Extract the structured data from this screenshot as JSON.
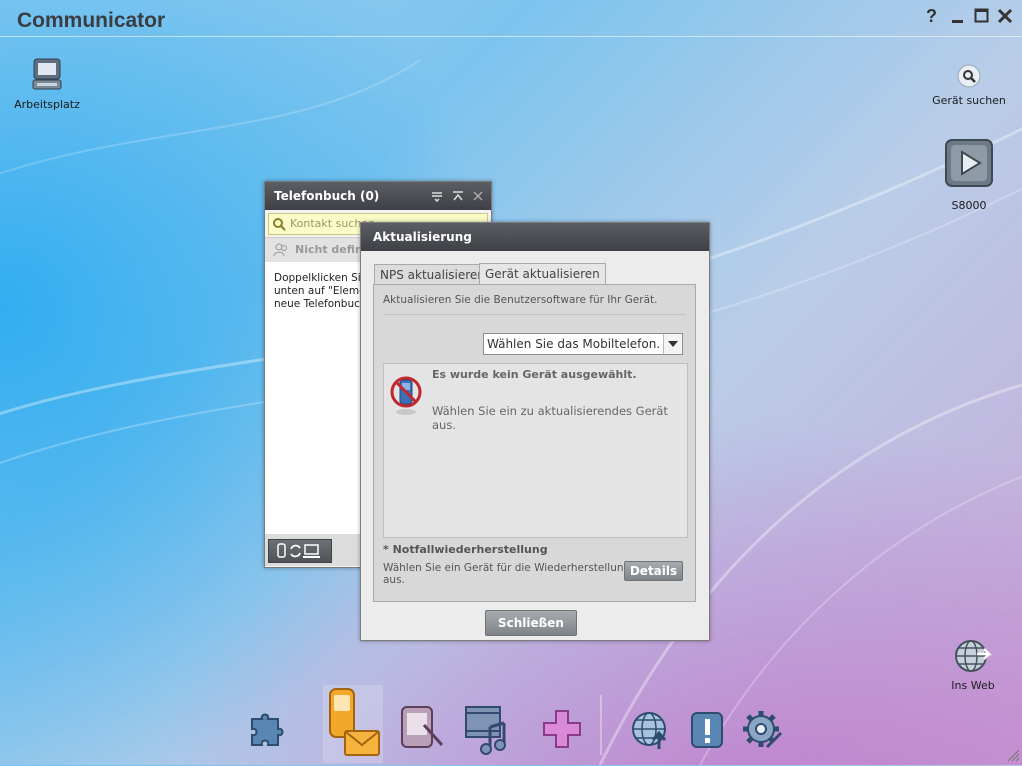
{
  "app": {
    "title": "Communicator"
  },
  "window_controls": {
    "help": "?",
    "minimize": "–",
    "maximize": "□",
    "close": "✕"
  },
  "desktop": {
    "my_computer": {
      "label": "Arbeitsplatz",
      "icon": "computer-icon"
    },
    "find_device": {
      "label": "Gerät suchen",
      "icon": "search-icon"
    },
    "device": {
      "label": "S8000",
      "icon": "play-icon"
    },
    "web": {
      "label": "Ins Web",
      "icon": "globe-icon"
    }
  },
  "phonebook": {
    "title": "Telefonbuch (0)",
    "search_placeholder": "Kontakt suchen",
    "group_label": "Nicht definiert",
    "hint_lines": [
      "Doppelklicken Sie hier oder klicken Sie",
      "unten auf \"Element hinzufügen\", um eine",
      "neue Telefonbuchnummer einzugeben."
    ]
  },
  "update_dialog": {
    "title": "Aktualisierung",
    "tabs": [
      {
        "label": "NPS aktualisieren",
        "active": false
      },
      {
        "label": "Gerät aktualisieren",
        "active": true
      }
    ],
    "description": "Aktualisieren Sie die Benutzersoftware für Ihr Gerät.",
    "device_select": {
      "value": "Wählen Sie das Mobiltelefon."
    },
    "no_device_title": "Es wurde kein Gerät ausgewählt.",
    "no_device_text_line1": "Wählen Sie ein zu aktualisierendes Gerät",
    "no_device_text_line2": "aus.",
    "recovery_title": "* Notfallwiederherstellung",
    "recovery_text_line1": "Wählen Sie ein Gerät für die Wiederherstellung",
    "recovery_text_line2": "aus.",
    "details_button": "Details",
    "close_button": "Schließen"
  },
  "dock": {
    "items": [
      {
        "name": "apps-puzzle-icon"
      },
      {
        "name": "phone-messages-icon",
        "active": true
      },
      {
        "name": "tablet-notes-icon"
      },
      {
        "name": "media-icon"
      },
      {
        "name": "add-icon"
      },
      {
        "name": "web-upload-icon"
      },
      {
        "name": "notice-icon"
      },
      {
        "name": "settings-icon"
      }
    ]
  },
  "colors": {
    "accent": "#f0a020",
    "dialog_header": "#3e4045",
    "button": "#8a8f94"
  }
}
